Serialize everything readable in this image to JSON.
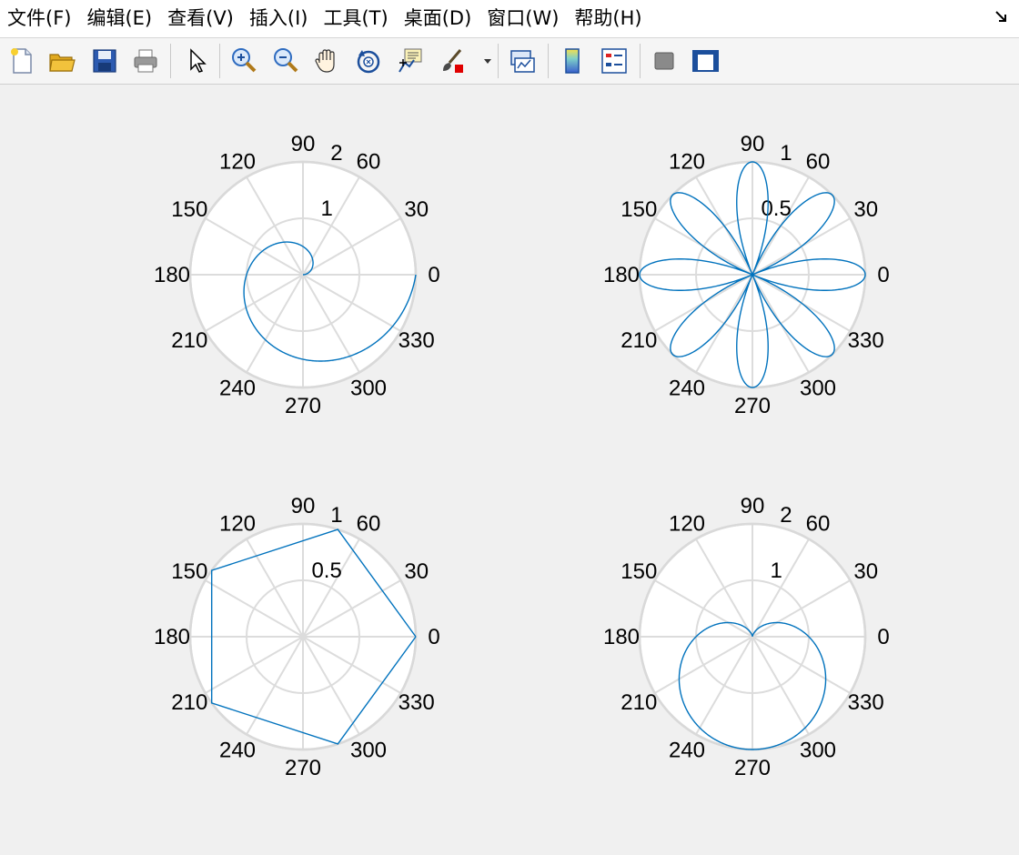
{
  "menubar": {
    "items": [
      "文件(F)",
      "编辑(E)",
      "查看(V)",
      "插入(I)",
      "工具(T)",
      "桌面(D)",
      "窗口(W)",
      "帮助(H)"
    ]
  },
  "toolbar": {
    "buttons": [
      {
        "name": "new-figure",
        "icon": "new-page-icon"
      },
      {
        "name": "open-file",
        "icon": "open-folder-icon"
      },
      {
        "name": "save-figure",
        "icon": "save-disk-icon"
      },
      {
        "name": "print-figure",
        "icon": "printer-icon"
      },
      {
        "name": "edit-plot",
        "icon": "pointer-arrow-icon"
      },
      {
        "name": "zoom-in",
        "icon": "zoom-in-icon"
      },
      {
        "name": "zoom-out",
        "icon": "zoom-out-icon"
      },
      {
        "name": "pan",
        "icon": "pan-hand-icon"
      },
      {
        "name": "rotate-3d",
        "icon": "rotate-3d-icon"
      },
      {
        "name": "data-cursor",
        "icon": "data-cursor-icon"
      },
      {
        "name": "brush",
        "icon": "brush-icon"
      },
      {
        "name": "link-plot",
        "icon": "link-plot-icon"
      },
      {
        "name": "insert-colorbar",
        "icon": "colorbar-icon"
      },
      {
        "name": "insert-legend",
        "icon": "legend-icon"
      },
      {
        "name": "hide-plot-tools",
        "icon": "hide-tools-icon"
      },
      {
        "name": "show-plot-tools",
        "icon": "show-tools-icon"
      }
    ],
    "colors": {
      "accent_blue": "#1c4f9c",
      "brush_red": "#e00000",
      "folder_yellow": "#f2c23c"
    }
  },
  "chart_data": [
    {
      "type": "line",
      "projection": "polar",
      "description_key": "spiral",
      "series": [
        {
          "function": "rho = theta / pi",
          "theta_range_deg": [
            0,
            360
          ],
          "color": "#0072bd"
        }
      ],
      "r_range": [
        0,
        2
      ],
      "r_tick_labels": [
        "1",
        "2"
      ],
      "theta_tick_labels": [
        "0",
        "30",
        "60",
        "90",
        "120",
        "150",
        "180",
        "210",
        "240",
        "270",
        "300",
        "330"
      ],
      "grid": true
    },
    {
      "type": "line",
      "projection": "polar",
      "series": [
        {
          "function": "rho = |cos(4 theta)|",
          "theta_range_deg": [
            0,
            360
          ],
          "color": "#0072bd"
        }
      ],
      "r_range": [
        0,
        1
      ],
      "r_tick_labels": [
        "0.5",
        "1"
      ],
      "theta_tick_labels": [
        "0",
        "30",
        "60",
        "90",
        "120",
        "150",
        "180",
        "210",
        "240",
        "270",
        "300",
        "330"
      ],
      "grid": true
    },
    {
      "type": "line",
      "projection": "polar",
      "series": [
        {
          "theta_deg": [
            0,
            72,
            144,
            216,
            288,
            360
          ],
          "rho": [
            1,
            1,
            1,
            1,
            1,
            1
          ],
          "color": "#0072bd"
        }
      ],
      "r_range": [
        0,
        1
      ],
      "r_tick_labels": [
        "0.5",
        "1"
      ],
      "theta_tick_labels": [
        "0",
        "30",
        "60",
        "90",
        "120",
        "150",
        "180",
        "210",
        "240",
        "270",
        "300",
        "330"
      ],
      "grid": true
    },
    {
      "type": "line",
      "projection": "polar",
      "series": [
        {
          "function": "rho = 1 - sin(theta)",
          "theta_range_deg": [
            0,
            360
          ],
          "color": "#0072bd"
        }
      ],
      "r_range": [
        0,
        2
      ],
      "r_tick_labels": [
        "1",
        "2"
      ],
      "theta_tick_labels": [
        "0",
        "30",
        "60",
        "90",
        "120",
        "150",
        "180",
        "210",
        "240",
        "270",
        "300",
        "330"
      ],
      "grid": true
    }
  ]
}
